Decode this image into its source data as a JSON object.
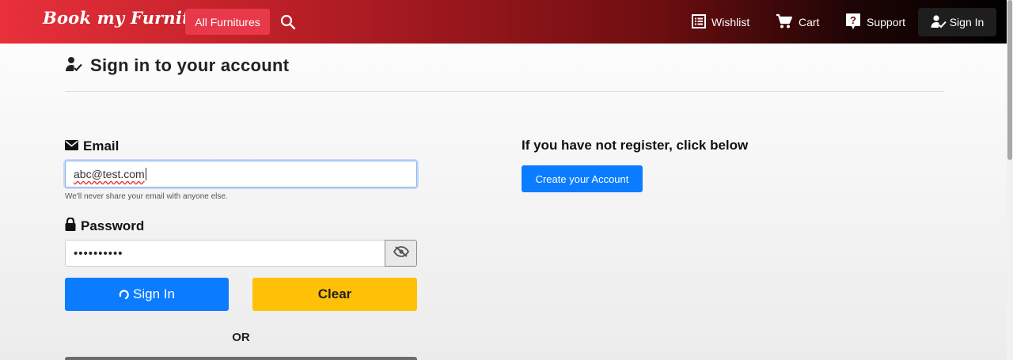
{
  "navbar": {
    "brand": "Book my Furniture",
    "all_furnitures": "All Furnitures",
    "search_icon": "search-icon",
    "wishlist": "Wishlist",
    "cart": "Cart",
    "support": "Support",
    "sign_in": "Sign In"
  },
  "page": {
    "heading": "Sign in to your account"
  },
  "form": {
    "email_label": "Email",
    "email_value": "abc@test.com",
    "email_help": "We'll never share your email with anyone else.",
    "password_label": "Password",
    "password_value": "••••••••••",
    "sign_in_button": "Sign In",
    "clear_button": "Clear",
    "or_text": "OR"
  },
  "register": {
    "heading": "If you have not register, click below",
    "create_button": "Create your Account"
  },
  "colors": {
    "primary": "#0b7cff",
    "warning": "#ffc107",
    "brand_red": "#e8303a",
    "nav_dark": "#1e1e1e"
  }
}
